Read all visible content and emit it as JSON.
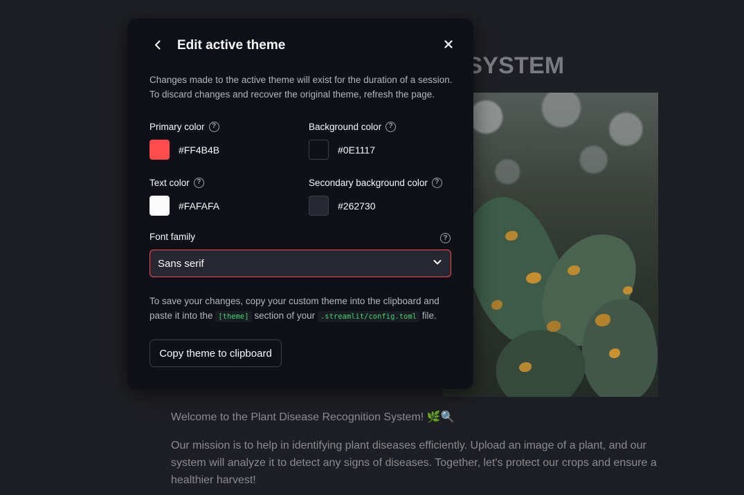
{
  "background_app": {
    "title_fragment": "N SYSTEM",
    "welcome_text": "Welcome to the Plant Disease Recognition System! 🌿🔍",
    "mission_text": "Our mission is to help in identifying plant diseases efficiently. Upload an image of a plant, and our system will analyze it to detect any signs of diseases. Together, let's protect our crops and ensure a healthier harvest!"
  },
  "modal": {
    "title": "Edit active theme",
    "description_line1": "Changes made to the active theme will exist for the duration of a session.",
    "description_line2": "To discard changes and recover the original theme, refresh the page.",
    "colors": [
      {
        "label": "Primary color",
        "value": "#FF4B4B"
      },
      {
        "label": "Background color",
        "value": "#0E1117"
      },
      {
        "label": "Text color",
        "value": "#FAFAFA"
      },
      {
        "label": "Secondary background color",
        "value": "#262730"
      }
    ],
    "font_family": {
      "label": "Font family",
      "selected": "Sans serif"
    },
    "save_text": {
      "line1": "To save your changes, copy your custom theme into the clipboard and",
      "line2_prefix": "paste it into the",
      "code1": "[theme]",
      "line2_middle": "section of your",
      "code2": ".streamlit/config.toml",
      "line2_suffix": "file."
    },
    "copy_button_label": "Copy theme to clipboard",
    "icons": {
      "back": "chevron-left-icon",
      "close": "close-icon",
      "help": "question-circle-icon",
      "dropdown": "chevron-down-icon"
    }
  }
}
